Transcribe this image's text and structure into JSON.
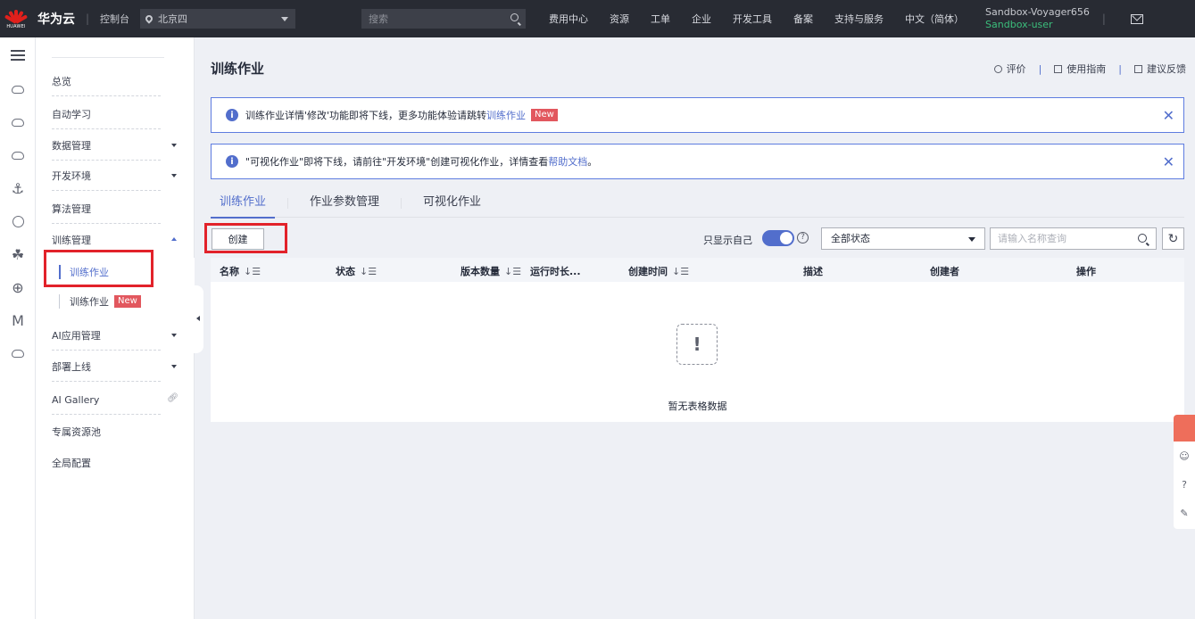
{
  "topbar": {
    "brand": "华为云",
    "logo_text": "HUAWEI",
    "console": "控制台",
    "region": "北京四",
    "search_placeholder": "搜索",
    "nav": [
      "费用中心",
      "资源",
      "工单",
      "企业",
      "开发工具",
      "备案",
      "支持与服务",
      "中文（简体）"
    ],
    "user_name": "Sandbox-Voyager656",
    "user_sub": "Sandbox-user"
  },
  "menu": {
    "overview": "总览",
    "automl": "自动学习",
    "data_mgmt": "数据管理",
    "dev_env": "开发环境",
    "algo_mgmt": "算法管理",
    "train_mgmt": "训练管理",
    "train_job": "训练作业",
    "train_job_new": "训练作业",
    "new_badge": "New",
    "ai_app": "AI应用管理",
    "deploy": "部署上线",
    "gallery": "AI Gallery",
    "dedicated_pool": "专属资源池",
    "global_config": "全局配置"
  },
  "page": {
    "title": "训练作业",
    "links": [
      "评价",
      "使用指南",
      "建议反馈"
    ]
  },
  "notices": [
    {
      "text": "训练作业详情'修改'功能即将下线，更多功能体验请跳转 ",
      "link": "训练作业",
      "badge": "New"
    },
    {
      "text": "\"可视化作业\"即将下线，请前往\"开发环境\"创建可视化作业，详情查看",
      "link": "帮助文档",
      "tail": "。"
    }
  ],
  "tabs": [
    "训练作业",
    "作业参数管理",
    "可视化作业"
  ],
  "toolbar": {
    "create": "创建",
    "only_mine": "只显示自己",
    "status_select": "全部状态",
    "search_placeholder": "请输入名称查询"
  },
  "table": {
    "columns": [
      "名称",
      "状态",
      "版本数量",
      "运行时长...",
      "创建时间",
      "描述",
      "创建者",
      "操作"
    ],
    "empty": "暂无表格数据"
  }
}
